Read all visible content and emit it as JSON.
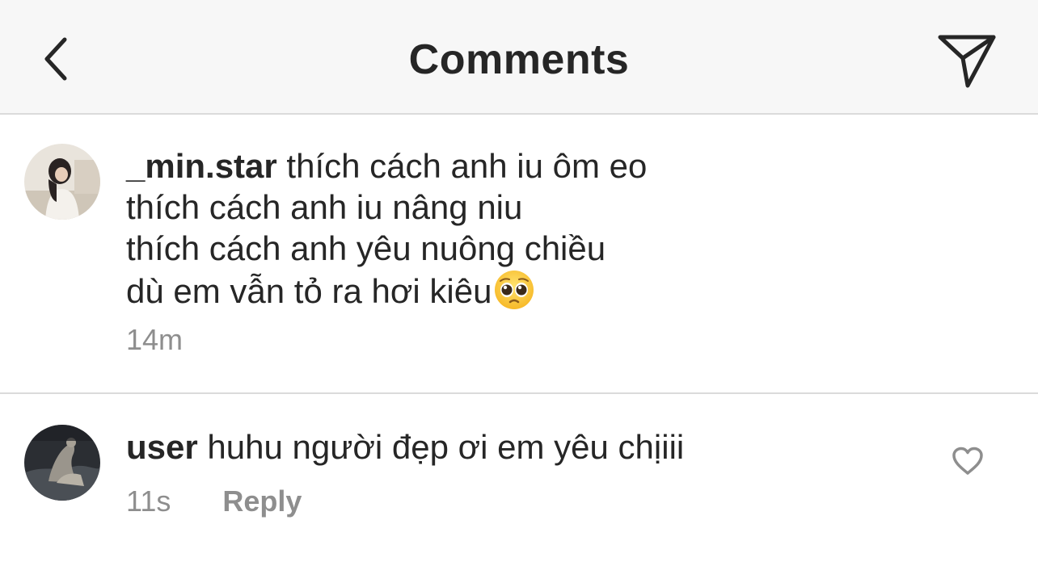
{
  "header": {
    "title": "Comments",
    "back_icon": "chevron-left-icon",
    "send_icon": "paper-plane-icon"
  },
  "caption": {
    "username": "_min.star",
    "lines": [
      "thích cách anh iu ôm eo",
      "thích cách anh iu nâng niu",
      "thích cách anh yêu nuông chiều",
      "dù em vẫn tỏ ra hơi kiêu"
    ],
    "emoji": "pleading-face-emoji",
    "time": "14m"
  },
  "comments": [
    {
      "username": "user",
      "text": "huhu người đẹp ơi em yêu chịiii",
      "time": "11s",
      "reply_label": "Reply",
      "like_icon": "heart-outline-icon"
    }
  ],
  "colors": {
    "header_bg": "#f7f7f7",
    "text": "#262626",
    "secondary": "#8e8e8e",
    "divider": "#dbdbdb"
  }
}
